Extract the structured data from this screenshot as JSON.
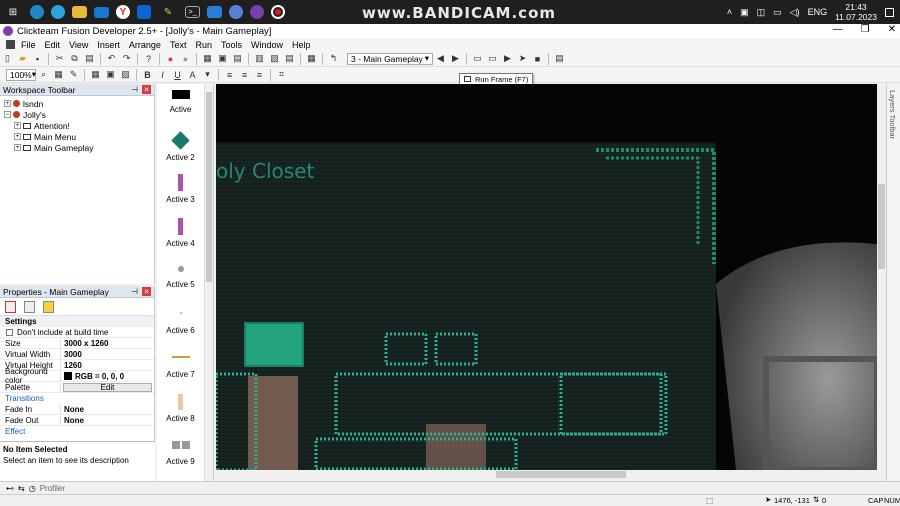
{
  "watermark": "www.BANDICAM.com",
  "tray": {
    "lang": "ENG",
    "time": "21:43",
    "date": "11.07.2023"
  },
  "window": {
    "title": "Clickteam Fusion Developer 2.5+ - [Jolly's - Main Gameplay]"
  },
  "menu": [
    "File",
    "Edit",
    "View",
    "Insert",
    "Arrange",
    "Text",
    "Run",
    "Tools",
    "Window",
    "Help"
  ],
  "toolbar": {
    "frame_select": "3 - Main Gameplay",
    "zoom": "100%"
  },
  "tooltip": {
    "run_frame": "Run Frame (F7)"
  },
  "workspace": {
    "title": "Workspace Toolbar",
    "items": [
      {
        "label": "lsndn",
        "level": 0
      },
      {
        "label": "Jolly's",
        "level": 0
      },
      {
        "label": "Attention!",
        "level": 1
      },
      {
        "label": "Main Menu",
        "level": 1
      },
      {
        "label": "Main Gameplay",
        "level": 1
      }
    ]
  },
  "properties": {
    "title": "Properties - Main Gameplay",
    "section": "Settings",
    "checkbox_label": "Don't include at build time",
    "rows": [
      {
        "k": "Size",
        "v": "3000 x 1260"
      },
      {
        "k": "Virtual Width",
        "v": "3000"
      },
      {
        "k": "Virtual Height",
        "v": "1260"
      },
      {
        "k": "Background color",
        "v": "RGB = 0, 0, 0"
      },
      {
        "k": "Palette",
        "v": "Edit"
      }
    ],
    "cat_transitions": "Transitions",
    "fade_in": {
      "k": "Fade In",
      "v": "None"
    },
    "fade_out": {
      "k": "Fade Out",
      "v": "None"
    },
    "cat_effect": "Effect",
    "desc_title": "No Item Selected",
    "desc_text": "Select an item to see its description"
  },
  "objects": [
    "Active",
    "Active 2",
    "Active 3",
    "Active 4",
    "Active 5",
    "Active 6",
    "Active 7",
    "Active 8",
    "Active 9"
  ],
  "frame_text": "oly Closet",
  "layers_label": "Layers Toolbar",
  "profiler": "Profiler",
  "status": {
    "coords": "1476, -131",
    "count": "0",
    "caps": "CAP",
    "num": "NUM"
  }
}
